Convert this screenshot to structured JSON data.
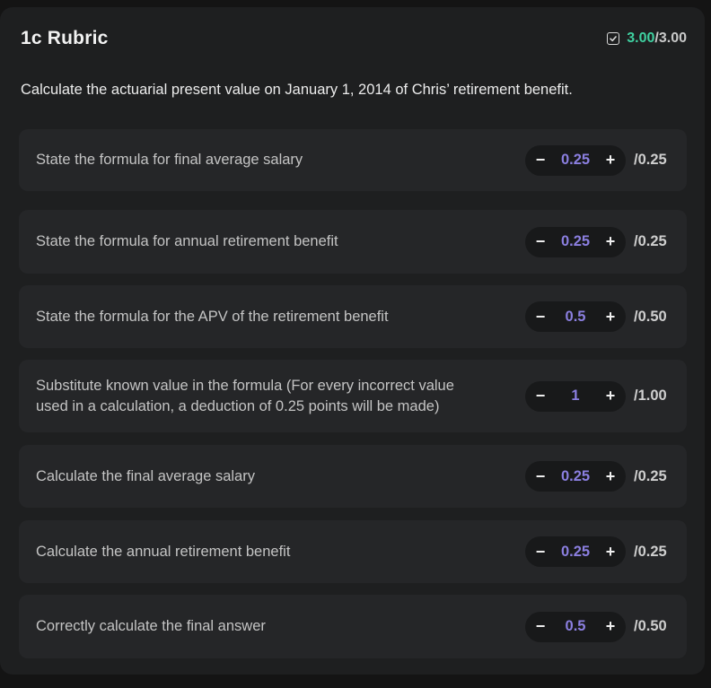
{
  "rubric": {
    "title": "1c Rubric",
    "score_earned": "3.00",
    "score_total": "/3.00",
    "question": "Calculate the actuarial present value on January 1, 2014 of Chris’ retirement benefit.",
    "colors": {
      "earned": "#3fd0a0",
      "value": "#8b7fe0",
      "panel": "#1e1f20",
      "card": "#252628"
    },
    "items": [
      {
        "label": "State the formula for final average salary",
        "value": "0.25",
        "max": "/0.25"
      },
      {
        "label": "State the formula for annual retirement benefit",
        "value": "0.25",
        "max": "/0.25"
      },
      {
        "label": "State the formula for the APV of the retirement benefit",
        "value": "0.5",
        "max": "/0.50"
      },
      {
        "label": "Substitute known value in the formula (For every incorrect value used in a calculation, a deduction of 0.25 points will be made)",
        "value": "1",
        "max": "/1.00"
      },
      {
        "label": "Calculate the final average salary",
        "value": "0.25",
        "max": "/0.25"
      },
      {
        "label": "Calculate the annual retirement benefit",
        "value": "0.25",
        "max": "/0.25"
      },
      {
        "label": "Correctly calculate the final answer",
        "value": "0.5",
        "max": "/0.50"
      }
    ],
    "stepper": {
      "decrement": "−",
      "increment": "+"
    }
  }
}
